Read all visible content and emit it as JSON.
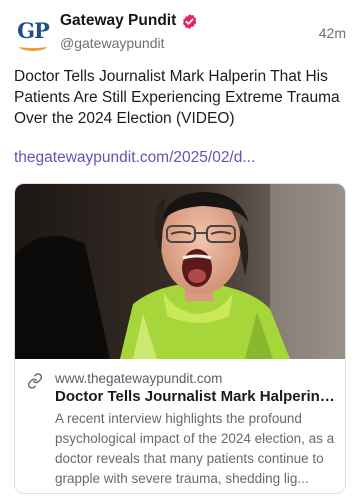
{
  "account": {
    "avatar_text": "GP",
    "name": "Gateway Pundit",
    "handle": "@gatewaypundit",
    "time": "42m",
    "verified_icon": "verified-badge-icon",
    "verified_color": "#e0245e"
  },
  "post": {
    "text": "Doctor Tells Journalist Mark Halperin That His Patients Are Still Experiencing Extreme Trauma Over the 2024 Election (VIDEO)",
    "link": "thegatewaypundit.com/2025/02/d...",
    "link_color": "#6a4fb8"
  },
  "card": {
    "image_icon": "protester-screaming-photo",
    "link_icon": "link-icon",
    "domain": "www.thegatewaypundit.com",
    "title": "Doctor Tells Journalist Mark Halperin ...",
    "description": "A recent interview highlights the profound psychological impact of the 2024 election, as a doctor reveals that many patients continue to grapple with severe trauma, shedding lig..."
  }
}
